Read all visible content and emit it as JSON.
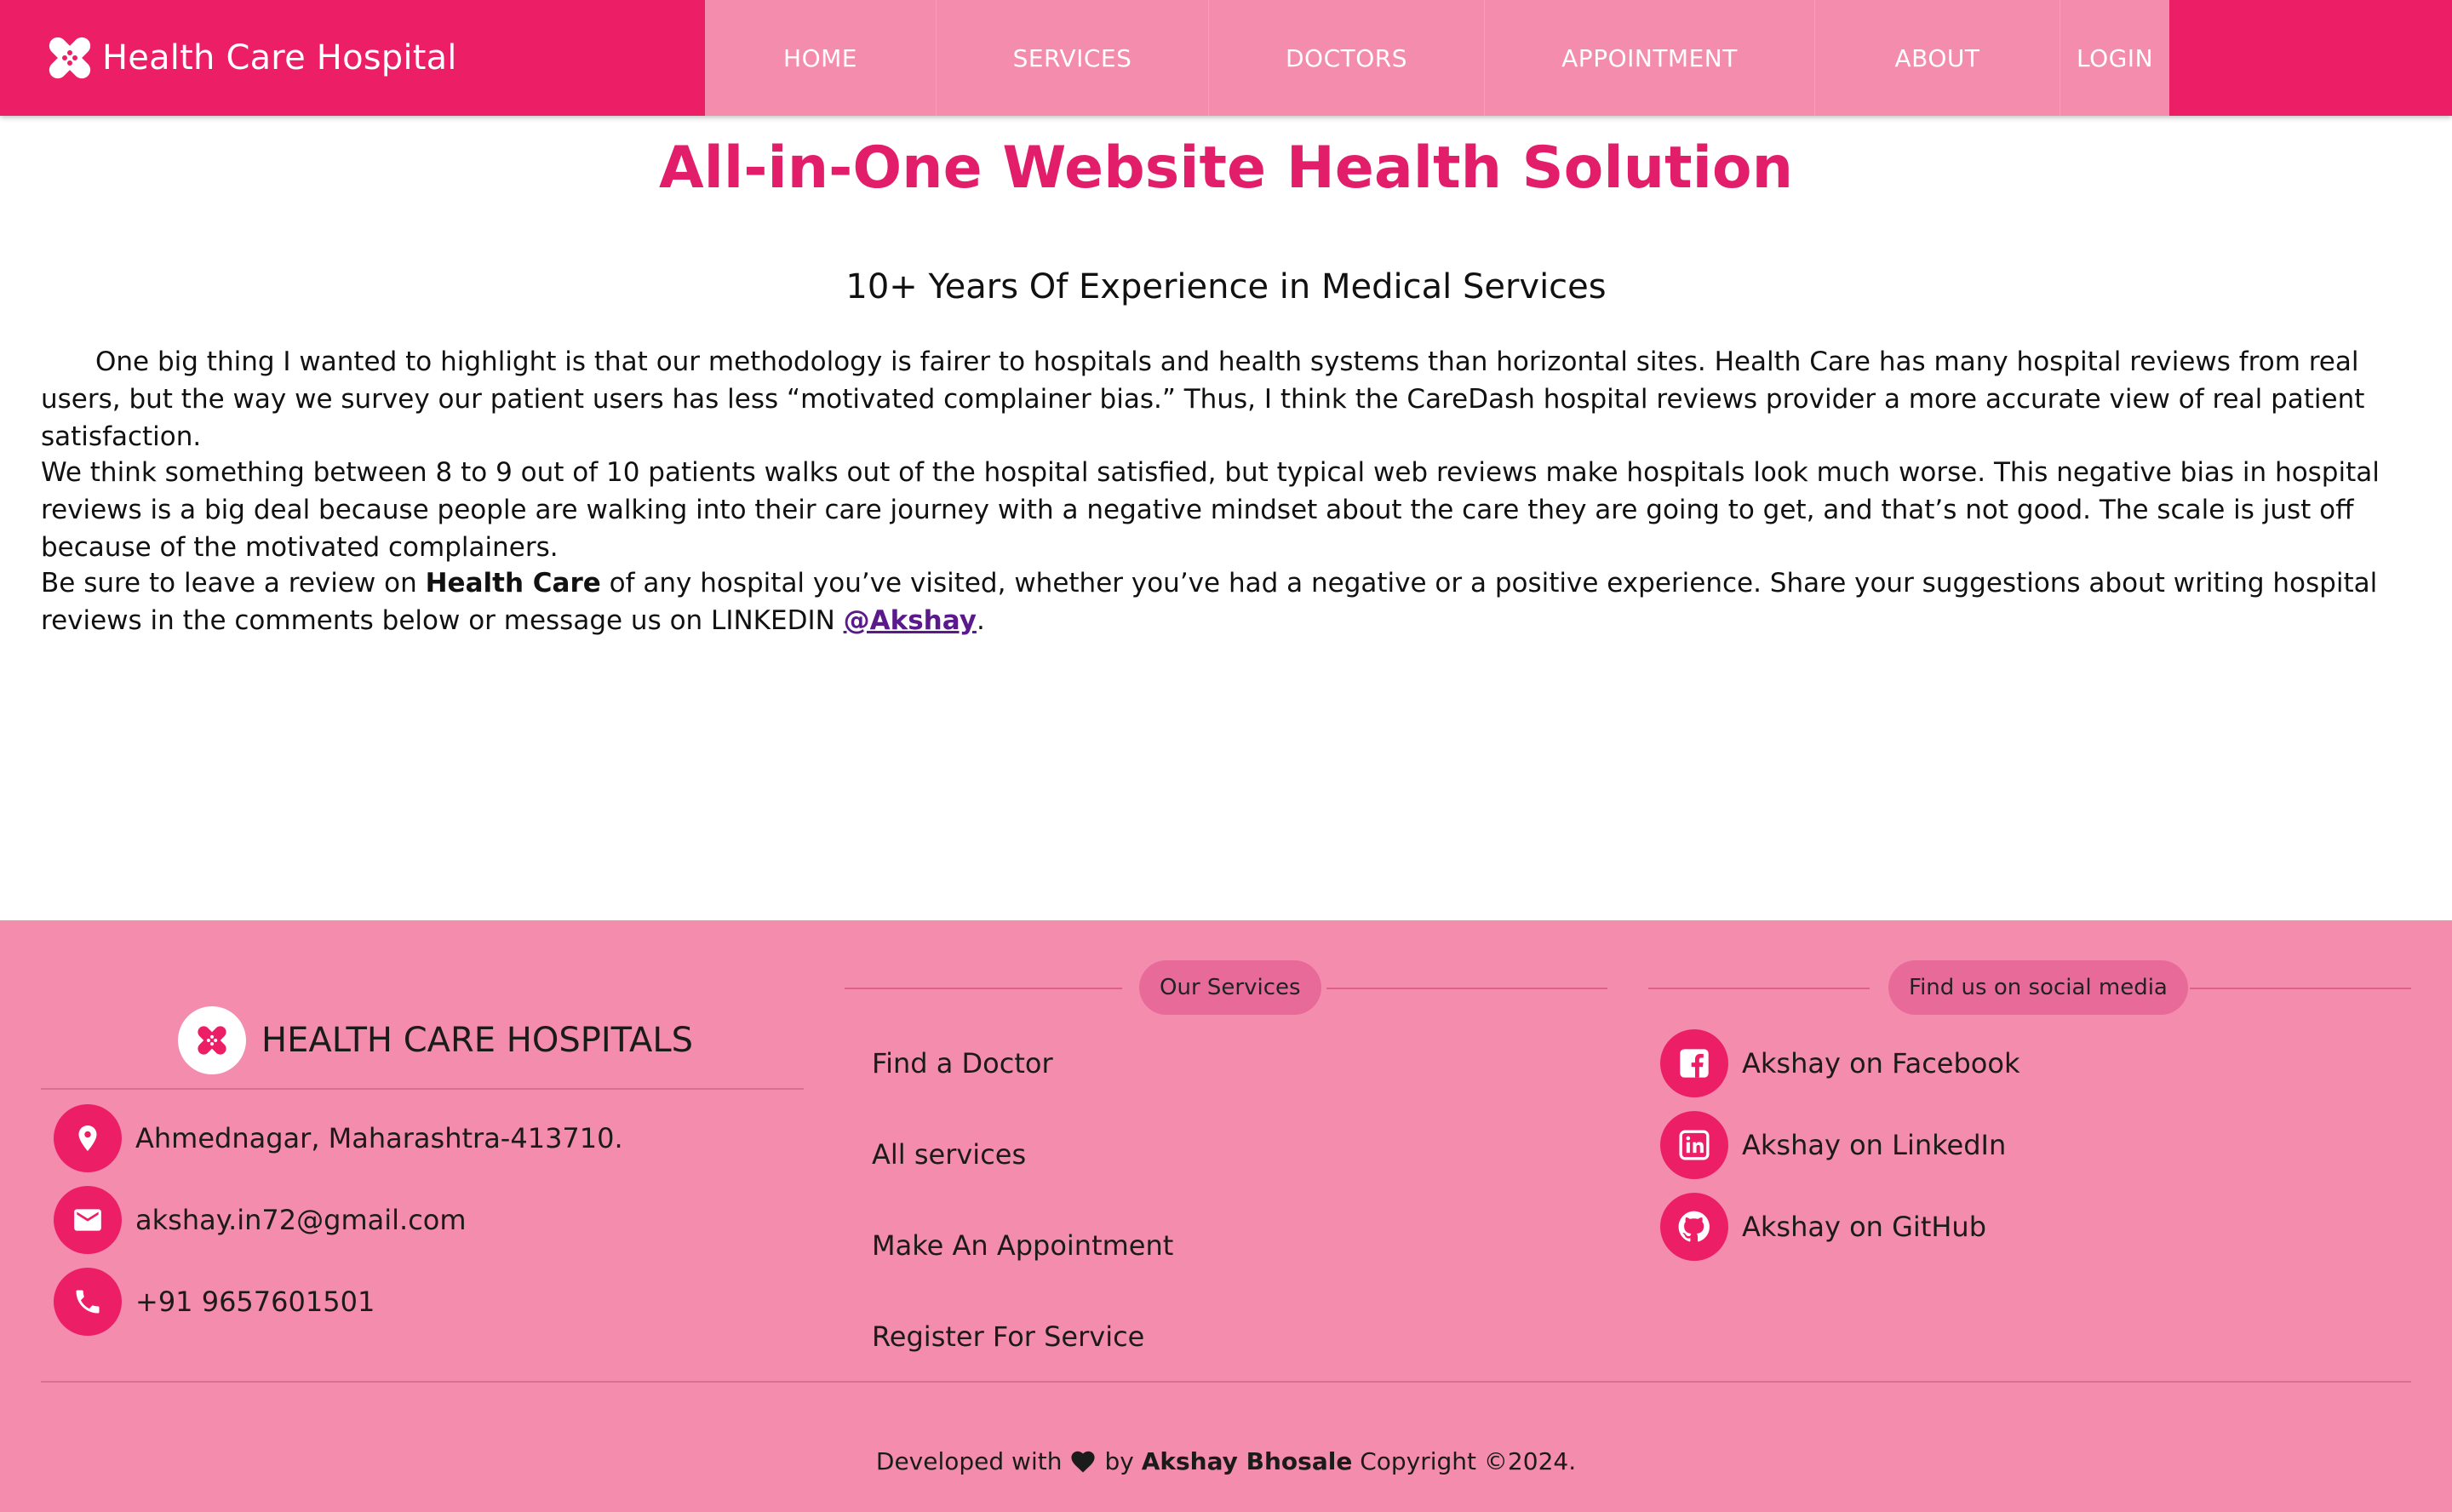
{
  "colors": {
    "brand": "#ec1f66",
    "nav_bg": "#f48cae",
    "title": "#e21e6a",
    "footer_bg": "#f48cae"
  },
  "nav": {
    "brand": "Health Care Hospital",
    "items": [
      {
        "label": "HOME"
      },
      {
        "label": "SERVICES"
      },
      {
        "label": "DOCTORS"
      },
      {
        "label": "APPOINTMENT"
      },
      {
        "label": "ABOUT"
      },
      {
        "label": "LOGIN"
      }
    ]
  },
  "main": {
    "title": "All-in-One Website Health Solution",
    "subtitle": "10+ Years Of Experience in Medical Services",
    "p1": "One big thing I wanted to highlight is that our methodology is fairer to hospitals and health systems than horizontal sites. Health Care has many hospital reviews from real users, but the way we survey our patient users has less “motivated complainer bias.” Thus, I think the CareDash hospital reviews provider a more accurate view of real patient satisfaction.",
    "p2": "We think something between 8 to 9 out of 10 patients walks out of the hospital satisfied, but typical web reviews make hospitals look much worse. This negative bias in hospital reviews is a big deal because people are walking into their care journey with a negative mindset about the care they are going to get, and that’s not good. The scale is just off because of the motivated complainers.",
    "p3_before": "Be sure to leave a review on ",
    "p3_bold": "Health Care",
    "p3_middle": " of any hospital you’ve visited, whether you’ve had a negative or a positive experience. Share your suggestions about writing hospital reviews in the comments below or message us on LINKEDIN ",
    "p3_link": "@Akshay",
    "p3_after": "."
  },
  "footer": {
    "brand": "HEALTH CARE HOSPITALS",
    "contacts": [
      {
        "icon": "location-pin-icon",
        "text": "Ahmednagar, Maharashtra-413710."
      },
      {
        "icon": "mail-icon",
        "text": "akshay.in72@gmail.com"
      },
      {
        "icon": "phone-icon",
        "text": "+91 9657601501"
      }
    ],
    "services_heading": "Our Services",
    "services": [
      {
        "label": "Find a Doctor"
      },
      {
        "label": "All services"
      },
      {
        "label": "Make An Appointment"
      },
      {
        "label": "Register For Service"
      }
    ],
    "social_heading": "Find us on social media",
    "social": [
      {
        "icon": "facebook-icon",
        "label": "Akshay on Facebook"
      },
      {
        "icon": "linkedin-icon",
        "label": "Akshay on LinkedIn"
      },
      {
        "icon": "github-icon",
        "label": "Akshay on GitHub"
      }
    ],
    "dev_prefix": "Developed with",
    "dev_by": "by",
    "dev_name": "Akshay Bhosale",
    "copyright": "Copyright ©2024."
  }
}
